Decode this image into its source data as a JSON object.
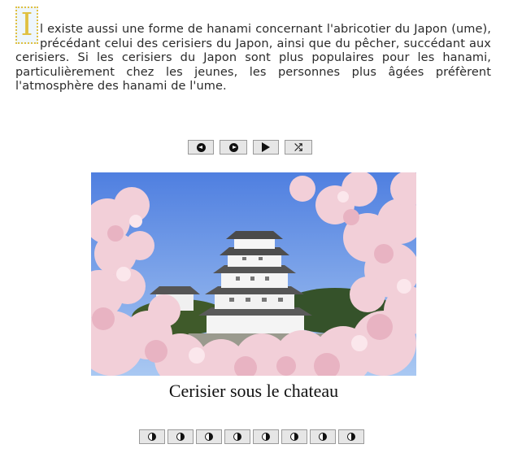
{
  "article": {
    "dropcap": "I",
    "text": "l existe aussi une forme de hanami concernant l'abricotier du Japon (ume), précédant celui des cerisiers du Japon, ainsi que du pêcher, succédant aux cerisiers. Si les cerisiers du Japon sont plus populaires pour les hanami, particulièrement chez les jeunes, les personnes plus âgées préfèrent l'atmosphère des hanami de l'ume."
  },
  "controls": {
    "previous_icon": "arrow-left-circle-icon",
    "next_icon": "arrow-right-circle-icon",
    "play_icon": "play-icon",
    "shuffle_icon": "shuffle-icon",
    "shuffle_glyph": "⤮"
  },
  "slide": {
    "caption": "Cerisier sous le chateau"
  },
  "slide_dots": {
    "count": 8,
    "icon": "half-circle-icon"
  },
  "colors": {
    "sky_top": "#4f7fe0",
    "sky_bottom": "#a9c8f2",
    "blossom": "#f2cfd8",
    "castle_wall": "#f4f4f4",
    "castle_roof": "#5a5a5a",
    "dropcap_border": "#e0c040"
  }
}
